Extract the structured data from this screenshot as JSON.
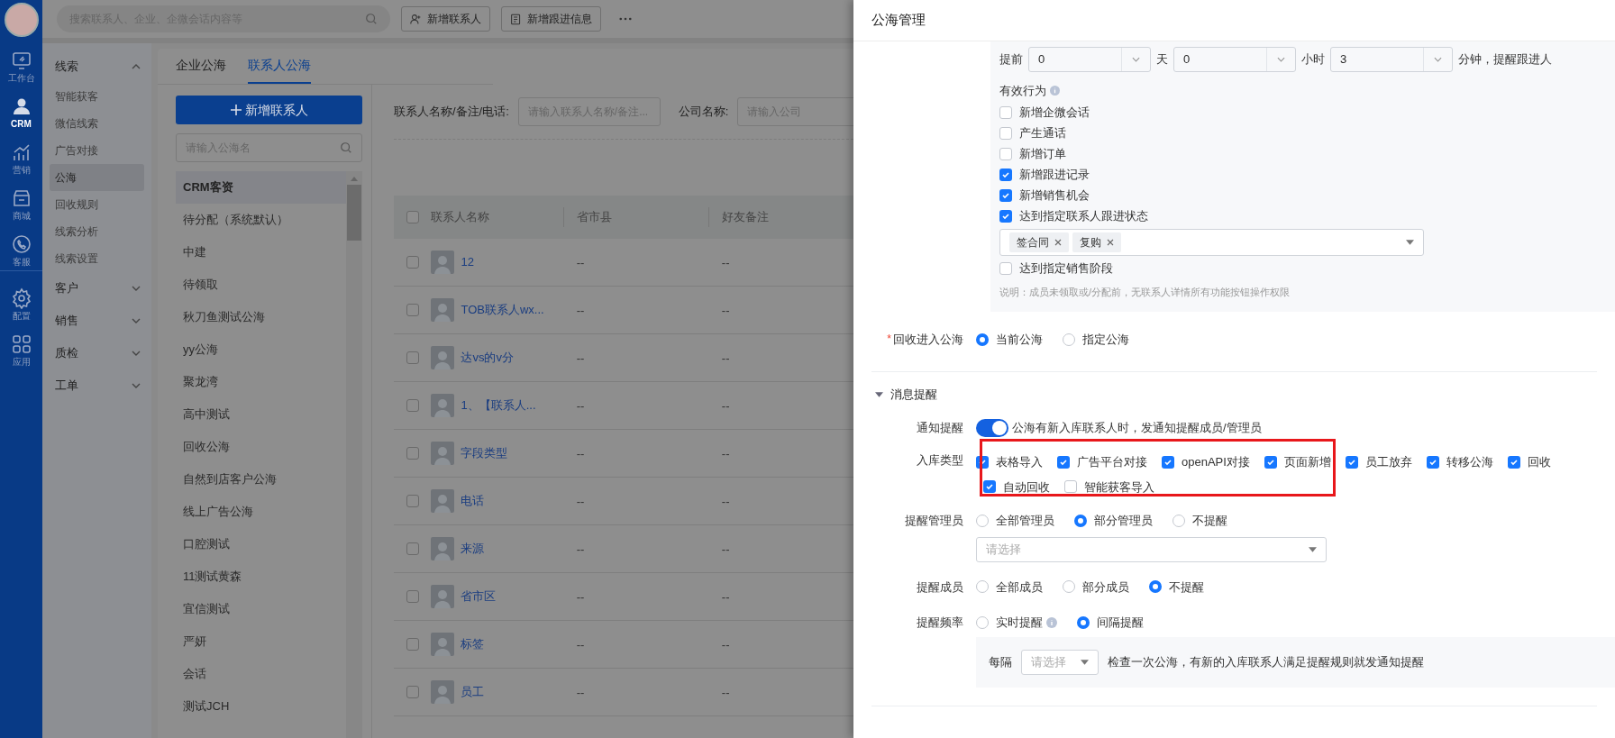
{
  "rail": {
    "items": [
      {
        "label": "工作台",
        "kind": "workbench",
        "selected": false
      },
      {
        "label": "CRM",
        "kind": "person",
        "selected": true
      },
      {
        "label": "营销",
        "kind": "chart",
        "selected": false
      },
      {
        "label": "商城",
        "kind": "store",
        "selected": false
      },
      {
        "label": "客服",
        "kind": "phone",
        "selected": false
      },
      {
        "label": "配置",
        "kind": "gear",
        "selected": false
      },
      {
        "label": "应用",
        "kind": "grid",
        "selected": false
      }
    ]
  },
  "top_bar": {
    "search": {
      "placeholder": "搜索联系人、企业、企微会话内容等"
    },
    "buttons": [
      {
        "label": "新增联系人",
        "kind": "person"
      },
      {
        "label": "新增跟进信息",
        "kind": "note"
      }
    ]
  },
  "nav": {
    "groups": [
      {
        "label": "线索",
        "expanded": true,
        "children": [
          {
            "label": "智能获客",
            "selected": false
          },
          {
            "label": "微信线索",
            "selected": false
          },
          {
            "label": "广告对接",
            "selected": false
          },
          {
            "label": "公海",
            "selected": true
          },
          {
            "label": "回收规则",
            "selected": false
          },
          {
            "label": "线索分析",
            "selected": false
          },
          {
            "label": "线索设置",
            "selected": false
          }
        ]
      },
      {
        "label": "客户",
        "expanded": false
      },
      {
        "label": "销售",
        "expanded": false
      },
      {
        "label": "质检",
        "expanded": false
      },
      {
        "label": "工单",
        "expanded": false
      }
    ]
  },
  "tabs": [
    {
      "label": "企业公海",
      "selected": false
    },
    {
      "label": "联系人公海",
      "selected": true
    }
  ],
  "pool_panel": {
    "add_button": "新增联系人",
    "search": {
      "placeholder": "请输入公海名"
    },
    "items": [
      {
        "label": "CRM客资",
        "selected": true
      },
      {
        "label": "待分配（系统默认）",
        "selected": false
      },
      {
        "label": "中建",
        "selected": false
      },
      {
        "label": "待领取",
        "selected": false
      },
      {
        "label": "秋刀鱼测试公海",
        "selected": false
      },
      {
        "label": "yy公海",
        "selected": false
      },
      {
        "label": "聚龙湾",
        "selected": false
      },
      {
        "label": "高中测试",
        "selected": false
      },
      {
        "label": "回收公海",
        "selected": false
      },
      {
        "label": "自然到店客户公海",
        "selected": false
      },
      {
        "label": "线上广告公海",
        "selected": false
      },
      {
        "label": "口腔测试",
        "selected": false
      },
      {
        "label": "11测试黄森",
        "selected": false
      },
      {
        "label": "宜信测试",
        "selected": false
      },
      {
        "label": "严妍",
        "selected": false
      },
      {
        "label": "会话",
        "selected": false
      },
      {
        "label": "测试JCH",
        "selected": false
      }
    ]
  },
  "filters": [
    {
      "label": "联系人名称/备注/电话:",
      "placeholder": "请输入联系人名称/备注..."
    },
    {
      "label": "公司名称:",
      "placeholder": "请输入公司"
    }
  ],
  "table": {
    "columns": [
      "联系人名称",
      "省市县",
      "好友备注"
    ],
    "all_selected": false,
    "rows": [
      {
        "name": "12",
        "region": "--",
        "note": "--",
        "selected": false
      },
      {
        "name": "TOB联系人wx...",
        "region": "--",
        "note": "--",
        "selected": false
      },
      {
        "name": "达vs的v分",
        "region": "--",
        "note": "--",
        "selected": false
      },
      {
        "name": "1、【联系人...",
        "region": "--",
        "note": "--",
        "selected": false
      },
      {
        "name": "字段类型",
        "region": "--",
        "note": "--",
        "selected": false
      },
      {
        "name": "电话",
        "region": "--",
        "note": "--",
        "selected": false
      },
      {
        "name": "来源",
        "region": "--",
        "note": "--",
        "selected": false
      },
      {
        "name": "省市区",
        "region": "--",
        "note": "--",
        "selected": false
      },
      {
        "name": "标签",
        "region": "--",
        "note": "--",
        "selected": false
      },
      {
        "name": "员工",
        "region": "--",
        "note": "--",
        "selected": false
      }
    ]
  },
  "drawer": {
    "title": "公海管理",
    "reminder": {
      "prefix": "提前",
      "days": "0",
      "day_unit": "天",
      "hours": "0",
      "hour_unit": "小时",
      "minutes": "3",
      "suffix": "分钟，提醒跟进人"
    },
    "actions": {
      "label": "有效行为",
      "items": [
        {
          "label": "新增企微会话",
          "checked": false
        },
        {
          "label": "产生通话",
          "checked": false
        },
        {
          "label": "新增订单",
          "checked": false
        },
        {
          "label": "新增跟进记录",
          "checked": true
        },
        {
          "label": "新增销售机会",
          "checked": true
        },
        {
          "label": "达到指定联系人跟进状态",
          "checked": true,
          "tags": [
            "签合同",
            "复购"
          ]
        },
        {
          "label": "达到指定销售阶段",
          "checked": false
        }
      ],
      "note": "说明：成员未领取或/分配前，无联系人详情所有功能按钮操作权限"
    },
    "recycle": {
      "label": "回收进入公海",
      "required_mark": "*",
      "options": [
        {
          "label": "当前公海",
          "selected": true
        },
        {
          "label": "指定公海",
          "selected": false
        }
      ]
    },
    "section": {
      "title": "消息提醒",
      "expanded": true
    },
    "notify": {
      "label": "通知提醒",
      "on": true,
      "text": "公海有新入库联系人时，发通知提醒成员/管理员"
    },
    "ingest": {
      "label": "入库类型",
      "highlighted": true,
      "options": [
        {
          "label": "表格导入",
          "checked": true
        },
        {
          "label": "广告平台对接",
          "checked": true
        },
        {
          "label": "openAPI对接",
          "checked": true
        },
        {
          "label": "页面新增",
          "checked": true
        },
        {
          "label": "员工放弃",
          "checked": true
        },
        {
          "label": "转移公海",
          "checked": true
        },
        {
          "label": "回收",
          "checked": true
        },
        {
          "label": "自动回收",
          "checked": true
        },
        {
          "label": "智能获客导入",
          "checked": false
        }
      ]
    },
    "admins": {
      "label": "提醒管理员",
      "options": [
        {
          "label": "全部管理员",
          "selected": false
        },
        {
          "label": "部分管理员",
          "selected": true
        },
        {
          "label": "不提醒",
          "selected": false
        }
      ],
      "select": {
        "placeholder": "请选择"
      }
    },
    "members": {
      "label": "提醒成员",
      "options": [
        {
          "label": "全部成员",
          "selected": false
        },
        {
          "label": "部分成员",
          "selected": false
        },
        {
          "label": "不提醒",
          "selected": true
        }
      ]
    },
    "frequency": {
      "label": "提醒频率",
      "options": [
        {
          "label": "实时提醒",
          "selected": false,
          "info": true
        },
        {
          "label": "间隔提醒",
          "selected": true,
          "info": false
        }
      ],
      "interval": {
        "label": "每隔",
        "placeholder": "请选择",
        "text": "检查一次公海，有新的入库联系人满足提醒规则就发通知提醒"
      }
    }
  }
}
